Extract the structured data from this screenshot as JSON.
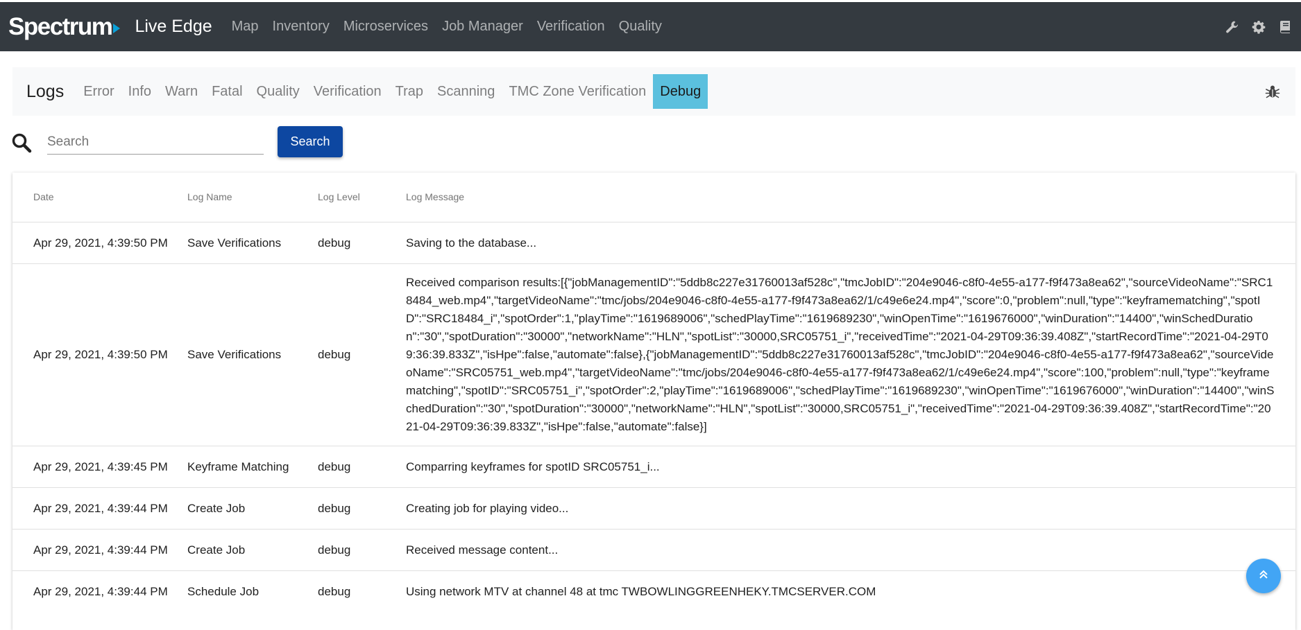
{
  "brand": {
    "logo": "Spectrum",
    "app_name": "Live Edge"
  },
  "nav": [
    "Map",
    "Inventory",
    "Microservices",
    "Job Manager",
    "Verification",
    "Quality"
  ],
  "top_icons": [
    "wrench-icon",
    "gear-icon",
    "book-icon"
  ],
  "logs_nav": {
    "title": "Logs",
    "tabs": [
      "Error",
      "Info",
      "Warn",
      "Fatal",
      "Quality",
      "Verification",
      "Trap",
      "Scanning",
      "TMC Zone Verification",
      "Debug"
    ],
    "active_tab": "Debug"
  },
  "search": {
    "placeholder": "Search",
    "value": "",
    "button_label": "Search"
  },
  "table": {
    "headers": [
      "Date",
      "Log Name",
      "Log Level",
      "Log Message"
    ],
    "rows": [
      {
        "date": "Apr 29, 2021, 4:39:50 PM",
        "name": "Save Verifications",
        "level": "debug",
        "message": "Saving to the database..."
      },
      {
        "date": "Apr 29, 2021, 4:39:50 PM",
        "name": "Save Verifications",
        "level": "debug",
        "message": "Received comparison results:[{\"jobManagementID\":\"5ddb8c227e31760013af528c\",\"tmcJobID\":\"204e9046-c8f0-4e55-a177-f9f473a8ea62\",\"sourceVideoName\":\"SRC18484_web.mp4\",\"targetVideoName\":\"tmc/jobs/204e9046-c8f0-4e55-a177-f9f473a8ea62/1/c49e6e24.mp4\",\"score\":0,\"problem\":null,\"type\":\"keyframematching\",\"spotID\":\"SRC18484_i\",\"spotOrder\":1,\"playTime\":\"1619689006\",\"schedPlayTime\":\"1619689230\",\"winOpenTime\":\"1619676000\",\"winDuration\":\"14400\",\"winSchedDuration\":\"30\",\"spotDuration\":\"30000\",\"networkName\":\"HLN\",\"spotList\":\"30000,SRC05751_i\",\"receivedTime\":\"2021-04-29T09:36:39.408Z\",\"startRecordTime\":\"2021-04-29T09:36:39.833Z\",\"isHpe\":false,\"automate\":false},{\"jobManagementID\":\"5ddb8c227e31760013af528c\",\"tmcJobID\":\"204e9046-c8f0-4e55-a177-f9f473a8ea62\",\"sourceVideoName\":\"SRC05751_web.mp4\",\"targetVideoName\":\"tmc/jobs/204e9046-c8f0-4e55-a177-f9f473a8ea62/1/c49e6e24.mp4\",\"score\":100,\"problem\":null,\"type\":\"keyframematching\",\"spotID\":\"SRC05751_i\",\"spotOrder\":2,\"playTime\":\"1619689006\",\"schedPlayTime\":\"1619689230\",\"winOpenTime\":\"1619676000\",\"winDuration\":\"14400\",\"winSchedDuration\":\"30\",\"spotDuration\":\"30000\",\"networkName\":\"HLN\",\"spotList\":\"30000,SRC05751_i\",\"receivedTime\":\"2021-04-29T09:36:39.408Z\",\"startRecordTime\":\"2021-04-29T09:36:39.833Z\",\"isHpe\":false,\"automate\":false}]"
      },
      {
        "date": "Apr 29, 2021, 4:39:45 PM",
        "name": "Keyframe Matching",
        "level": "debug",
        "message": "Comparring keyframes for spotID SRC05751_i..."
      },
      {
        "date": "Apr 29, 2021, 4:39:44 PM",
        "name": "Create Job",
        "level": "debug",
        "message": "Creating job for playing video..."
      },
      {
        "date": "Apr 29, 2021, 4:39:44 PM",
        "name": "Create Job",
        "level": "debug",
        "message": "Received message content..."
      },
      {
        "date": "Apr 29, 2021, 4:39:44 PM",
        "name": "Schedule Job",
        "level": "debug",
        "message": "Using network MTV at channel 48 at tmc TWBOWLINGGREENHEKY.TMCSERVER.COM"
      }
    ]
  },
  "colors": {
    "topbar": "#343a40",
    "active_tab": "#5bc0de",
    "search_button": "#0d47a1",
    "scroll_top": "#42a5f5"
  }
}
